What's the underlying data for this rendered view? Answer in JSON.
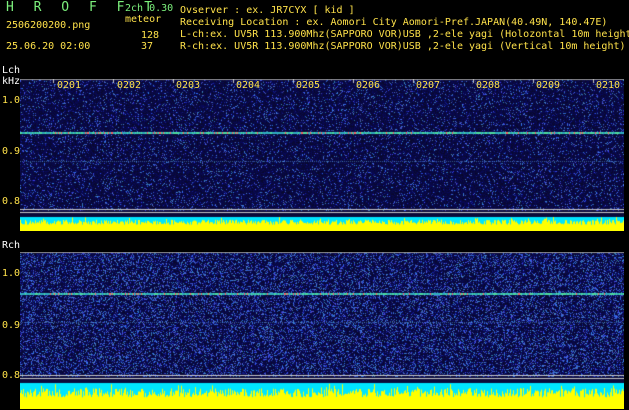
{
  "header": {
    "app_title": "H R O F F T",
    "version": "2ch 0.30",
    "filename": "2506200200.png",
    "datetime": "25.06.20 02:00",
    "meteor_label": "meteor",
    "lch_count": "128",
    "rch_count": "37",
    "observer": "Ovserver            : ex. JR7CYX [ kid ]",
    "location": "Receiving Location : ex. Aomori City Aomori-Pref.JAPAN(40.49N, 140.47E)",
    "lch_info": "L-ch:ex. UV5R 113.900Mhz(SAPPORO VOR)USB ,2-ele yagi (Holozontal 10m height",
    "rch_info": "R-ch:ex. UV5R 113.900Mhz(SAPPORO VOR)USB ,2-ele yagi (Vertical 10m height)"
  },
  "lch": {
    "label": "Lch",
    "unit": "kHz",
    "y_ticks": [
      "1.0",
      "0.9",
      "0.8"
    ],
    "time_ticks": [
      "0201",
      "0202",
      "0203",
      "0204",
      "0205",
      "0206",
      "0207",
      "0208",
      "0209",
      "0210"
    ]
  },
  "rch": {
    "label": "Rch",
    "y_ticks": [
      "1.0",
      "0.9",
      "0.8"
    ]
  },
  "colors": {
    "text_yellow": "#ffe24a",
    "title_green": "#7cf07c",
    "signal_line": "#4fe0a0",
    "bar_yellow": "#ffff00",
    "bar_cyan": "#00e5ff"
  }
}
